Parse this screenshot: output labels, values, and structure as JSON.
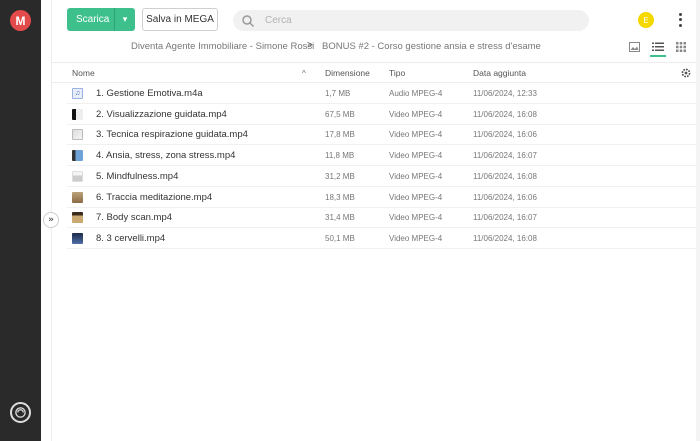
{
  "rail": {
    "logo_letter": "M"
  },
  "toolbar": {
    "download_label": "Scarica",
    "save_label": "Salva in MEGA",
    "search_placeholder": "Cerca",
    "avatar_initial": "E"
  },
  "breadcrumb": {
    "parent": "Diventa Agente Immobiliare - Simone Rossi",
    "separator": ">",
    "current": "BONUS #2 - Corso gestione ansia e stress d'esame"
  },
  "table": {
    "headers": {
      "name": "Nome",
      "size": "Dimensione",
      "type": "Tipo",
      "date": "Data aggiunta"
    },
    "rows": [
      {
        "name": "1. Gestione Emotiva.m4a",
        "size": "1,7 MB",
        "type": "Audio MPEG-4",
        "date": "11/06/2024, 12:33",
        "thumb": "t-audio"
      },
      {
        "name": "2. Visualizzazione guidata.mp4",
        "size": "67,5 MB",
        "type": "Video MPEG-4",
        "date": "11/06/2024, 16:08",
        "thumb": "t-v1"
      },
      {
        "name": "3. Tecnica respirazione guidata.mp4",
        "size": "17,8 MB",
        "type": "Video MPEG-4",
        "date": "11/06/2024, 16:06",
        "thumb": "t-v2"
      },
      {
        "name": "4. Ansia, stress, zona stress.mp4",
        "size": "11,8 MB",
        "type": "Video MPEG-4",
        "date": "11/06/2024, 16:07",
        "thumb": "t-v3"
      },
      {
        "name": "5. Mindfulness.mp4",
        "size": "31,2 MB",
        "type": "Video MPEG-4",
        "date": "11/06/2024, 16:08",
        "thumb": "t-v4"
      },
      {
        "name": "6. Traccia meditazione.mp4",
        "size": "18,3 MB",
        "type": "Video MPEG-4",
        "date": "11/06/2024, 16:06",
        "thumb": "t-v5"
      },
      {
        "name": "7. Body scan.mp4",
        "size": "31,4 MB",
        "type": "Video MPEG-4",
        "date": "11/06/2024, 16:07",
        "thumb": "t-v6"
      },
      {
        "name": "8. 3 cervelli.mp4",
        "size": "50,1 MB",
        "type": "Video MPEG-4",
        "date": "11/06/2024, 16:08",
        "thumb": "t-v7"
      }
    ]
  }
}
